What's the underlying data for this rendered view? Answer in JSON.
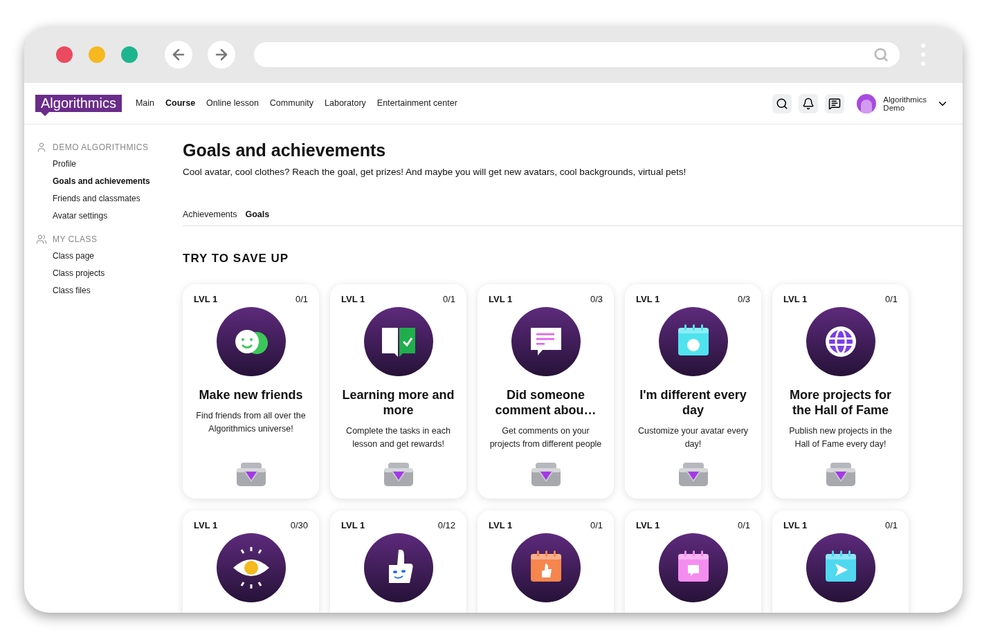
{
  "nav": {
    "logo": "Algorithmics",
    "links": [
      {
        "label": "Main",
        "selected": false
      },
      {
        "label": "Course",
        "selected": true
      },
      {
        "label": "Online lesson",
        "selected": false
      },
      {
        "label": "Community",
        "selected": false
      },
      {
        "label": "Laboratory",
        "selected": false
      },
      {
        "label": "Entertainment center",
        "selected": false
      }
    ],
    "user": {
      "first_name": "Algorithmics",
      "last_name": "Demo"
    }
  },
  "sidebar": [
    {
      "heading": "DEMO ALGORITHMICS",
      "kind": "person",
      "items": [
        {
          "label": "Profile",
          "selected": false
        },
        {
          "label": "Goals and achievements",
          "selected": true
        },
        {
          "label": "Friends and classmates",
          "selected": false
        },
        {
          "label": "Avatar settings",
          "selected": false
        }
      ]
    },
    {
      "heading": "MY CLASS",
      "kind": "group",
      "items": [
        {
          "label": "Class page",
          "selected": false
        },
        {
          "label": "Class projects",
          "selected": false
        },
        {
          "label": "Class files",
          "selected": false
        }
      ]
    }
  ],
  "page": {
    "title": "Goals and achievements",
    "subtitle": "Cool avatar, cool clothes? Reach the goal, get prizes! And maybe you will get new avatars, cool backgrounds, virtual pets!",
    "tabs": [
      {
        "label": "Achievements",
        "selected": false
      },
      {
        "label": "Goals",
        "selected": true
      }
    ],
    "section_title": "TRY TO SAVE UP",
    "goals": [
      {
        "level": "LVL 1",
        "progress": "0/1",
        "title": "Make new friends",
        "description": "Find friends from all over the Algorithmics universe!"
      },
      {
        "level": "LVL 1",
        "progress": "0/1",
        "title": "Learning more and more",
        "description": "Complete the tasks in each lesson and get rewards!"
      },
      {
        "level": "LVL 1",
        "progress": "0/3",
        "title": "Did someone comment abou…",
        "description": "Get comments on your projects from different people"
      },
      {
        "level": "LVL 1",
        "progress": "0/3",
        "title": "I'm different every day",
        "description": "Customize your avatar every day!"
      },
      {
        "level": "LVL 1",
        "progress": "0/1",
        "title": "More projects for the Hall of Fame",
        "description": "Publish new projects in the Hall of Fame every day!"
      },
      {
        "level": "LVL 1",
        "progress": "0/30"
      },
      {
        "level": "LVL 1",
        "progress": "0/12"
      },
      {
        "level": "LVL 1",
        "progress": "0/1"
      },
      {
        "level": "LVL 1",
        "progress": "0/1"
      },
      {
        "level": "LVL 1",
        "progress": "0/1"
      }
    ]
  }
}
